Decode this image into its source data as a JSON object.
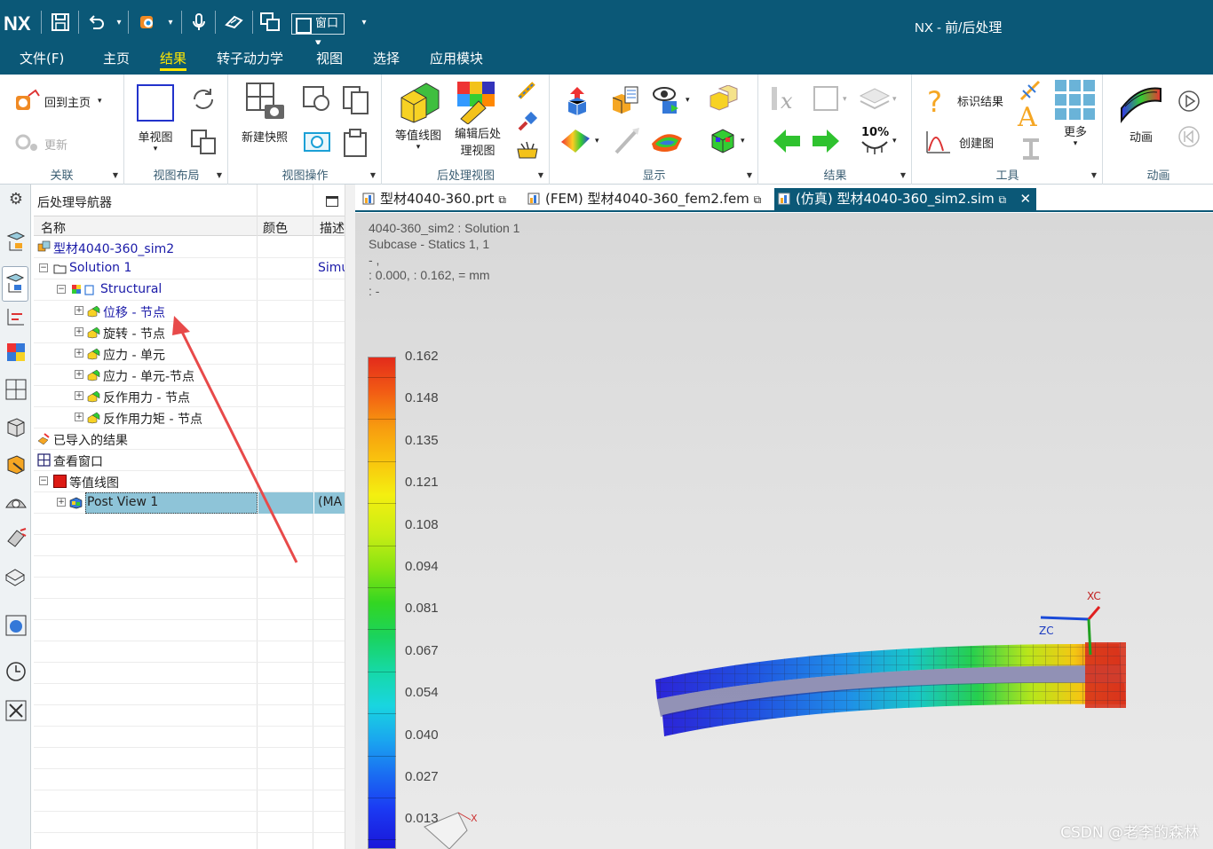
{
  "app": {
    "brand": "NX",
    "title": "NX - 前/后处理",
    "window_menu": "窗口"
  },
  "menubar": [
    "文件(F)",
    "主页",
    "结果",
    "转子动力学",
    "视图",
    "选择",
    "应用模块"
  ],
  "active_menu": "结果",
  "ribbon": {
    "groups": [
      "关联",
      "视图布局",
      "视图操作",
      "后处理视图",
      "显示",
      "结果",
      "工具",
      "动画"
    ],
    "buttons": {
      "back_home": "回到主页",
      "update": "更新",
      "single_view": "单视图",
      "new_snapshot": "新建快照",
      "contour": "等值线图",
      "edit_post_view_1": "编辑后处",
      "edit_post_view_2": "理视图",
      "identify_result": "标识结果",
      "create_graph": "创建图",
      "more": "更多",
      "animation": "动画",
      "percent": "10%"
    }
  },
  "navigator": {
    "title": "后处理导航器",
    "columns": [
      "名称",
      "颜色",
      "描述"
    ],
    "rows": [
      {
        "label": "型材4040-360_sim2",
        "desc": ""
      },
      {
        "label": "Solution 1",
        "desc": "Simu"
      },
      {
        "label": "Structural",
        "desc": ""
      },
      {
        "label": "位移 - 节点",
        "desc": ""
      },
      {
        "label": "旋转 - 节点",
        "desc": ""
      },
      {
        "label": "应力 - 单元",
        "desc": ""
      },
      {
        "label": "应力 - 单元-节点",
        "desc": ""
      },
      {
        "label": "反作用力 - 节点",
        "desc": ""
      },
      {
        "label": "反作用力矩 - 节点",
        "desc": ""
      },
      {
        "label": "已导入的结果",
        "desc": ""
      },
      {
        "label": "查看窗口",
        "desc": ""
      },
      {
        "label": "等值线图",
        "desc": ""
      },
      {
        "label": "Post View 1",
        "desc": "(MA"
      }
    ]
  },
  "tabs": [
    {
      "label": "型材4040-360.prt",
      "active": false
    },
    {
      "label": "(FEM) 型材4040-360_fem2.fem",
      "active": false
    },
    {
      "label": "(仿真) 型材4040-360_sim2.sim",
      "active": true
    }
  ],
  "viewport": {
    "info": [
      "4040-360_sim2 : Solution 1",
      "Subcase - Statics 1,  1",
      " - ,",
      " : 0.000,  : 0.162,  = mm",
      " :  -"
    ],
    "legend": {
      "values": [
        "0.162",
        "0.148",
        "0.135",
        "0.121",
        "0.108",
        "0.094",
        "0.081",
        "0.067",
        "0.054",
        "0.040",
        "0.027",
        "0.013"
      ]
    },
    "triad": {
      "x": "XC",
      "z": "ZC",
      "small_x": "X"
    }
  },
  "watermark": "CSDN @老李的森林",
  "colors": {
    "header": "#0b5877",
    "active_menu": "#ffe600",
    "selected_row": "#8ec4d8",
    "arrow": "#e84a4a"
  }
}
